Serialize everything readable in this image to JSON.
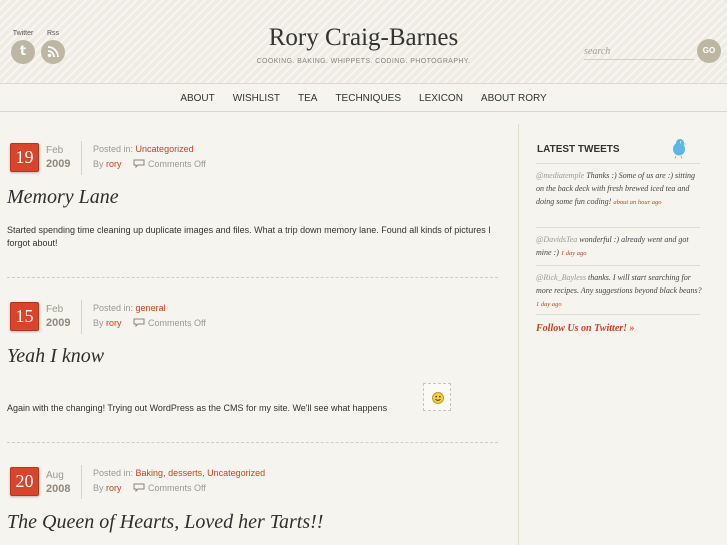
{
  "header": {
    "site_title": "Rory Craig-Barnes",
    "tagline": "COOKING. BAKING. WHIPPETS. CODING. PHOTOGRAPHY.",
    "twitter_label": "Twitter",
    "rss_label": "Rss",
    "search_placeholder": "search",
    "search_button": "GO"
  },
  "nav": {
    "items": [
      "ABOUT",
      "WISHLIST",
      "TEA",
      "TECHNIQUES",
      "LEXICON",
      "ABOUT RORY"
    ]
  },
  "posts": [
    {
      "day": "19",
      "month": "Feb",
      "year": "2009",
      "posted_in_label": "Posted in:",
      "categories": "Uncategorized",
      "by_label": "By",
      "author": "rory",
      "comments": "Comments Off",
      "title": "Memory Lane",
      "body": "Started spending time cleaning up duplicate images and files. What a trip down memory lane. Found all kinds of pictures I forgot about!"
    },
    {
      "day": "15",
      "month": "Feb",
      "year": "2009",
      "posted_in_label": "Posted in:",
      "categories": "general",
      "by_label": "By",
      "author": "rory",
      "comments": "Comments Off",
      "title": "Yeah I know",
      "body": "Again with the changing! Trying out WordPress as the CMS for my site. We'll see what happens"
    },
    {
      "day": "20",
      "month": "Aug",
      "year": "2008",
      "posted_in_label": "Posted in:",
      "categories": "Baking, desserts, Uncategorized",
      "by_label": "By",
      "author": "rory",
      "comments": "Comments Off",
      "title": "The Queen of Hearts, Loved her Tarts!!"
    }
  ],
  "sidebar": {
    "title": "LATEST TWEETS",
    "tweets": [
      {
        "handle": "@mediatemple",
        "text": " Thanks :) Some of us are :) sitting on the back deck with fresh brewed iced tea and doing some fun coding!",
        "ago": "about an hour ago"
      },
      {
        "handle": "@DavidsTea",
        "text": " wonderful :) already went and got mine :)",
        "ago": "1 day ago"
      },
      {
        "handle": "@Rick_Bayless",
        "text": " thanks. I will start searching for more recipes. Any suggestions beyond black beans?",
        "ago": "1 day ago"
      }
    ],
    "follow": "Follow Us on Twitter! »"
  },
  "colors": {
    "accent": "#c8441f",
    "badge": "#d8452a",
    "icon_grey": "#bdb6a2"
  }
}
